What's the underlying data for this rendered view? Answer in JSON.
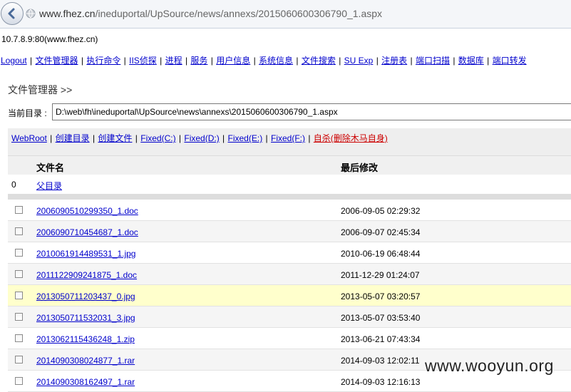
{
  "browser": {
    "url_host": "www.fhez.cn",
    "url_path": "/ineduportal/UpSource/news/annexs/2015060600306790_1.aspx"
  },
  "server_info": "10.7.8.9:80(www.fhez.cn)",
  "nav": [
    {
      "label": "Logout"
    },
    {
      "label": "文件管理器"
    },
    {
      "label": "执行命令"
    },
    {
      "label": "IIS侦探"
    },
    {
      "label": "进程"
    },
    {
      "label": "服务"
    },
    {
      "label": "用户信息"
    },
    {
      "label": "系统信息"
    },
    {
      "label": "文件搜索"
    },
    {
      "label": "SU Exp"
    },
    {
      "label": "注册表"
    },
    {
      "label": "端口扫描"
    },
    {
      "label": "数据库"
    },
    {
      "label": "端口转发"
    }
  ],
  "page_title": "文件管理器 >>",
  "current_dir": {
    "label": "当前目录 :",
    "value": "D:\\web\\fh\\ineduportal\\UpSource\\news\\annexs\\2015060600306790_1.aspx"
  },
  "tools": [
    {
      "label": "WebRoot"
    },
    {
      "label": "创建目录"
    },
    {
      "label": "创建文件"
    },
    {
      "label": "Fixed(C:)"
    },
    {
      "label": "Fixed(D:)"
    },
    {
      "label": "Fixed(E:)"
    },
    {
      "label": "Fixed(F:)"
    },
    {
      "label": "自杀(删除木马自身)"
    }
  ],
  "table": {
    "col_name": "文件名",
    "col_modified": "最后修改",
    "parent": {
      "num": "0",
      "label": "父目录"
    },
    "rows": [
      {
        "name": "2006090510299350_1.doc",
        "modified": "2006-09-05 02:29:32"
      },
      {
        "name": "2006090710454687_1.doc",
        "modified": "2006-09-07 02:45:34"
      },
      {
        "name": "2010061914489531_1.jpg",
        "modified": "2010-06-19 06:48:44"
      },
      {
        "name": "2011122909241875_1.doc",
        "modified": "2011-12-29 01:24:07"
      },
      {
        "name": "2013050711203437_0.jpg",
        "modified": "2013-05-07 03:20:57"
      },
      {
        "name": "2013050711532031_3.jpg",
        "modified": "2013-05-07 03:53:40"
      },
      {
        "name": "2013062115436248_1.zip",
        "modified": "2013-06-21 07:43:34"
      },
      {
        "name": "2014090308024877_1.rar",
        "modified": "2014-09-03 12:02:11"
      },
      {
        "name": "2014090308162497_1.rar",
        "modified": "2014-09-03 12:16:13"
      }
    ]
  },
  "watermark": "www.wooyun.org"
}
